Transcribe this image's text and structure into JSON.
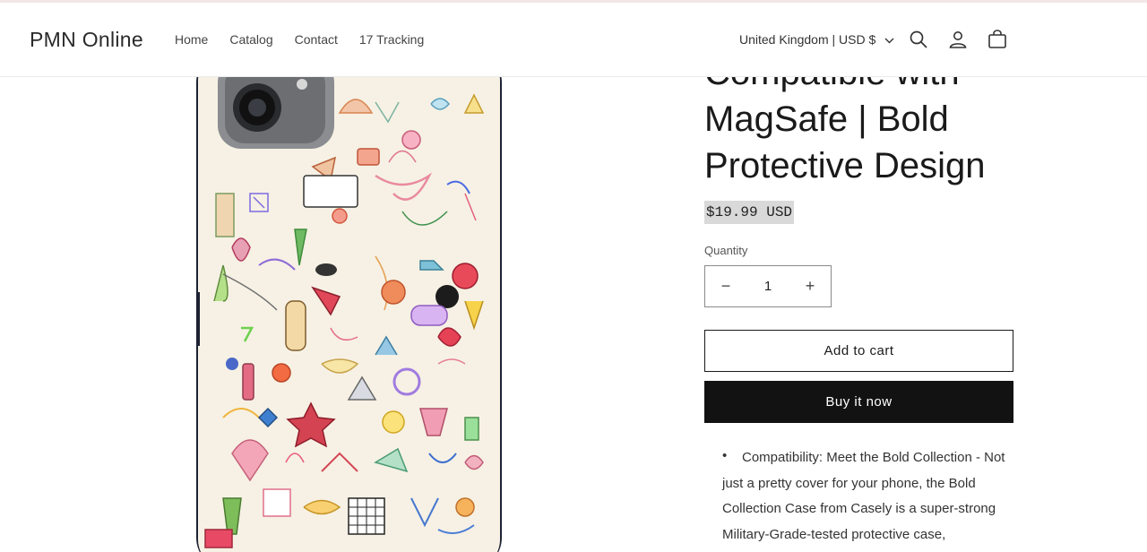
{
  "store": {
    "name": "PMN Online"
  },
  "nav": {
    "items": [
      "Home",
      "Catalog",
      "Contact",
      "17 Tracking"
    ]
  },
  "locale": {
    "label": "United Kingdom | USD $"
  },
  "icons": {
    "search": "search-icon",
    "account": "user-icon",
    "cart": "cart-icon",
    "locale_caret": "chevron-down-icon"
  },
  "product": {
    "title_line_0": "Compatible with",
    "title_line_1": "MagSafe | Bold",
    "title_line_2": "Protective Design",
    "price": "$19.99 USD",
    "quantity_label": "Quantity",
    "quantity_value": "1",
    "decrease_symbol": "−",
    "increase_symbol": "+",
    "add_to_cart": "Add to cart",
    "buy_now": "Buy it now",
    "bullet": "•",
    "description": "Compatibility: Meet the Bold Collection - Not just a pretty cover for your phone, the Bold Collection Case from Casely is a super-strong Military-Grade-tested protective case,"
  },
  "colors": {
    "accent": "#121212",
    "price_highlight": "#d9d9d9",
    "case_background": "#f6f1e4"
  }
}
